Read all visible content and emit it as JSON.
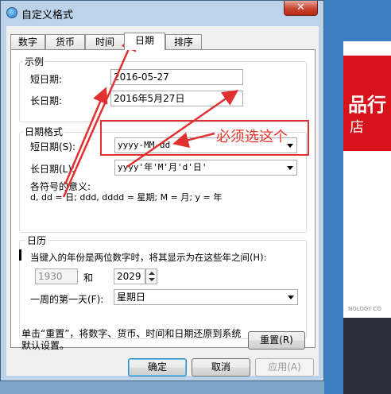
{
  "window": {
    "title": "自定义格式",
    "close_label": "✕"
  },
  "tabs": [
    "数字",
    "货币",
    "时间",
    "日期",
    "排序"
  ],
  "active_tab": "日期",
  "example": {
    "group_label": "示例",
    "short_label": "短日期:",
    "short_value": "2016-05-27",
    "long_label": "长日期:",
    "long_value": "2016年5月27日"
  },
  "date_format": {
    "group_label": "日期格式",
    "short_label": "短日期(S):",
    "short_value": "yyyy-MM-dd",
    "long_label": "长日期(L):",
    "long_value": "yyyy'年'M'月'd'日'",
    "legend_title": "各符号的意义:",
    "legend_text": "d, dd = 日;  ddd, dddd = 星期;  M = 月;  y = 年"
  },
  "calendar": {
    "group_label": "日历",
    "two_digit_text": "当键入的年份是两位数字时，将其显示为在这些年之间(H):",
    "year_from": "1930",
    "and_label": "和",
    "year_to": "2029",
    "first_day_label": "一周的第一天(F):",
    "first_day_value": "星期日"
  },
  "reset": {
    "note": "单击“重置”，将数字、货币、时间和日期还原到系统默认设置。",
    "button_label": "重置(R)"
  },
  "buttons": {
    "ok": "确定",
    "cancel": "取消",
    "apply": "应用(A)"
  },
  "annotation": {
    "text": "必须选这个",
    "color": "#e8382b"
  },
  "background": {
    "text1": "品行",
    "text2": "店",
    "text3": "NOLOGY CO"
  }
}
